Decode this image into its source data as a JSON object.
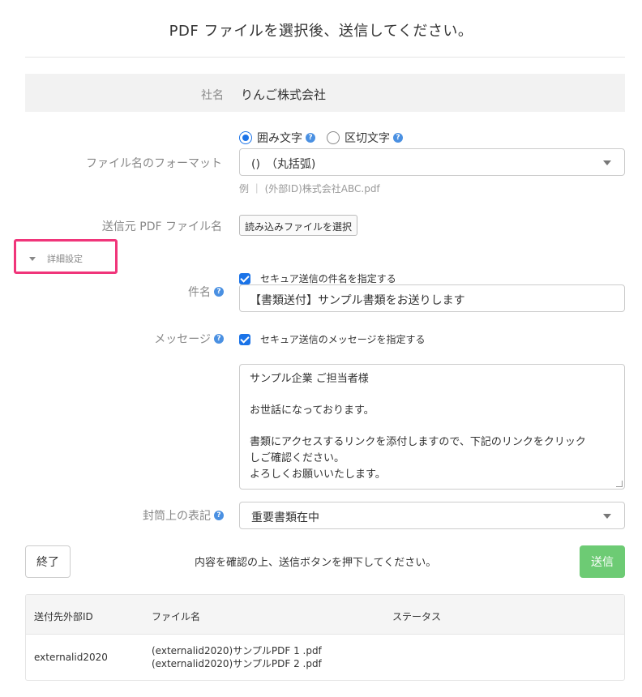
{
  "page": {
    "title": "PDF ファイルを選択後、送信してください。"
  },
  "company": {
    "label": "社名",
    "value": "りんご株式会社"
  },
  "filename_format": {
    "label": "ファイル名のフォーマット",
    "options": [
      {
        "label": "囲み文字",
        "checked": true,
        "help_icon": "question-circle-icon"
      },
      {
        "label": "区切文字",
        "checked": false,
        "help_icon": "question-circle-icon"
      }
    ],
    "selected": "()　（丸括弧)",
    "example": "例 ｜ (外部ID)株式会社ABC.pdf"
  },
  "source_pdf": {
    "label": "送信元 PDF ファイル名",
    "button_label": "読み込みファイルを選択"
  },
  "details": {
    "label": "詳細設定",
    "highlight_color": "#f0357a"
  },
  "subject": {
    "label": "件名",
    "help_icon": "question-circle-icon",
    "checkbox_label": "セキュア送信の件名を指定する",
    "checked": true,
    "value": "【書類送付】サンプル書類をお送りします"
  },
  "message": {
    "label": "メッセージ",
    "help_icon": "question-circle-icon",
    "checkbox_label": "セキュア送信のメッセージを指定する",
    "checked": true,
    "lines": [
      "サンプル企業 ご担当者様",
      "",
      "お世話になっております。",
      "",
      "書類にアクセスするリンクを添付しますので、下記のリンクをクリック",
      "しご確認ください。",
      "よろしくお願いいたします。"
    ]
  },
  "envelope": {
    "label": "封筒上の表記",
    "help_icon": "question-circle-icon",
    "selected": "重要書類在中"
  },
  "actions": {
    "end_label": "終了",
    "confirm_text": "内容を確認の上、送信ボタンを押下してください。",
    "send_label": "送信",
    "send_color": "#6dcb74"
  },
  "table": {
    "headers": [
      "送付先外部ID",
      "ファイル名",
      "ステータス"
    ],
    "rows": [
      {
        "external_id": "externalid2020",
        "files": [
          "(externalid2020)サンプルPDF 1 .pdf",
          "(externalid2020)サンプルPDF 2 .pdf"
        ],
        "status": ""
      }
    ]
  },
  "colors": {
    "accent": "#1a73e8",
    "help": "#4a90e2",
    "label": "#888888"
  }
}
